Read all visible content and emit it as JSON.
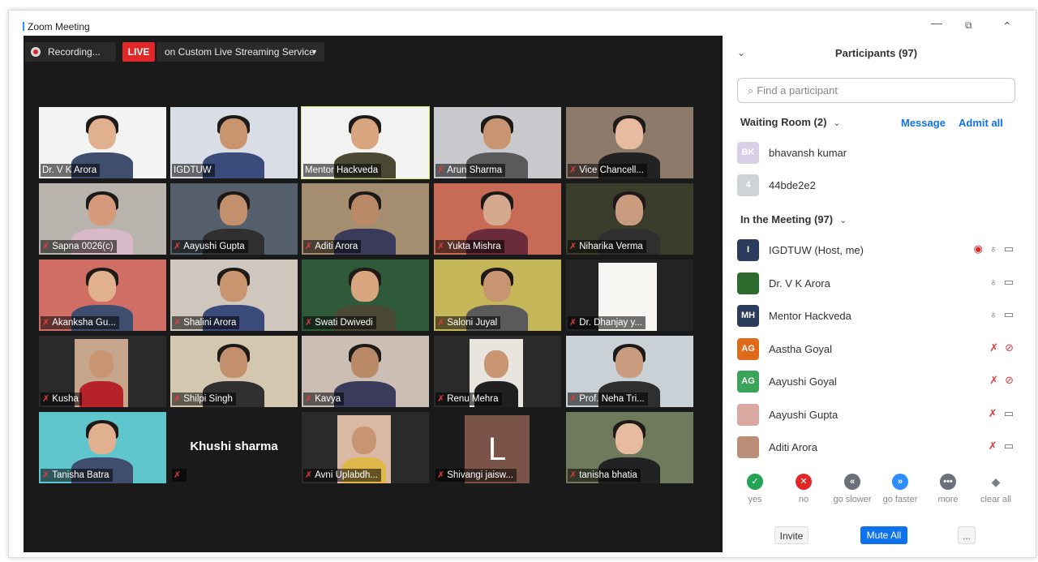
{
  "window": {
    "title": "Zoom Meeting",
    "minimize": "—",
    "restore": "⧉",
    "collapse": "⌃"
  },
  "toolbar": {
    "recording": "Recording...",
    "live": "LIVE",
    "stream": "on Custom Live Streaming Service",
    "stream_caret": "▼"
  },
  "tiles": [
    {
      "label": "Dr. V K Arora",
      "muted": false
    },
    {
      "label": "IGDTUW",
      "muted": false
    },
    {
      "label": "Mentor Hackveda",
      "muted": false,
      "active": true
    },
    {
      "label": "Arun Sharma",
      "muted": true
    },
    {
      "label": "Vice Chancell...",
      "muted": true
    },
    {
      "label": "Sapna 0026(c)",
      "muted": true
    },
    {
      "label": "Aayushi Gupta",
      "muted": true
    },
    {
      "label": "Aditi Arora",
      "muted": true
    },
    {
      "label": "Yukta Mishra",
      "muted": true
    },
    {
      "label": "Niharika Verma",
      "muted": true
    },
    {
      "label": "Akanksha Gu...",
      "muted": true
    },
    {
      "label": "Shalini Arora",
      "muted": true
    },
    {
      "label": "Swati Dwivedi",
      "muted": true
    },
    {
      "label": "Saloni Juyal",
      "muted": true
    },
    {
      "label": "Dr. Dhanjay y...",
      "muted": true
    },
    {
      "label": "Kusha",
      "muted": true
    },
    {
      "label": "Shilpi Singh",
      "muted": true
    },
    {
      "label": "Kavya",
      "muted": true
    },
    {
      "label": "Renu Mehra",
      "muted": true
    },
    {
      "label": "Prof. Neha Tri...",
      "muted": true
    },
    {
      "label": "Tanisha Batra",
      "muted": true
    },
    {
      "label": "",
      "muted": true,
      "bigname": "Khushi sharma"
    },
    {
      "label": "Avni Uplabdh...",
      "muted": true
    },
    {
      "label": "Shivangi jaisw...",
      "muted": true,
      "letter": "L"
    },
    {
      "label": "tanisha bhatia",
      "muted": true
    }
  ],
  "panel": {
    "collapse": "⌄",
    "title": "Participants (97)",
    "search_placeholder": "Find a participant",
    "waiting_room": "Waiting Room (2)",
    "message": "Message",
    "admit_all": "Admit all",
    "waiting": [
      {
        "initials": "BK",
        "name": "bhavansh kumar",
        "color": "#d8cfe8"
      },
      {
        "initials": "4",
        "name": "44bde2e2",
        "color": "#cfd3d8"
      }
    ],
    "in_meeting": "In the Meeting (97)",
    "participants": [
      {
        "initials": "I",
        "name": "IGDTUW (Host, me)",
        "color": "#2a3d5e",
        "recording": true,
        "muted": false,
        "video_off": false
      },
      {
        "initials": "",
        "name": "Dr. V K Arora",
        "color": "#2c6a2e",
        "recording": false,
        "muted": false,
        "video_off": false
      },
      {
        "initials": "MH",
        "name": "Mentor Hackveda",
        "color": "#2a3d5e",
        "recording": false,
        "muted": false,
        "video_off": false
      },
      {
        "initials": "AG",
        "name": "Aastha Goyal",
        "color": "#e06a1a",
        "recording": false,
        "muted": true,
        "video_off": true
      },
      {
        "initials": "AG",
        "name": "Aayushi Goyal",
        "color": "#3aa55a",
        "recording": false,
        "muted": true,
        "video_off": true
      },
      {
        "initials": "",
        "name": "Aayushi Gupta",
        "color": "#d9a8a0",
        "recording": false,
        "muted": true,
        "video_off": false
      },
      {
        "initials": "",
        "name": "Aditi Arora",
        "color": "#b98d76",
        "recording": false,
        "muted": true,
        "video_off": false
      }
    ],
    "reactions": [
      {
        "label": "yes",
        "glyph": "✓",
        "color": "#23a455"
      },
      {
        "label": "no",
        "glyph": "✕",
        "color": "#e02828"
      },
      {
        "label": "go slower",
        "glyph": "«",
        "color": "#6b7079"
      },
      {
        "label": "go faster",
        "glyph": "»",
        "color": "#2d8cff"
      },
      {
        "label": "more",
        "glyph": "•••",
        "color": "#6b7079"
      },
      {
        "label": "clear all",
        "glyph": "◆",
        "color": "#ffffff"
      }
    ],
    "invite": "Invite",
    "mute_all": "Mute All",
    "more": "..."
  }
}
